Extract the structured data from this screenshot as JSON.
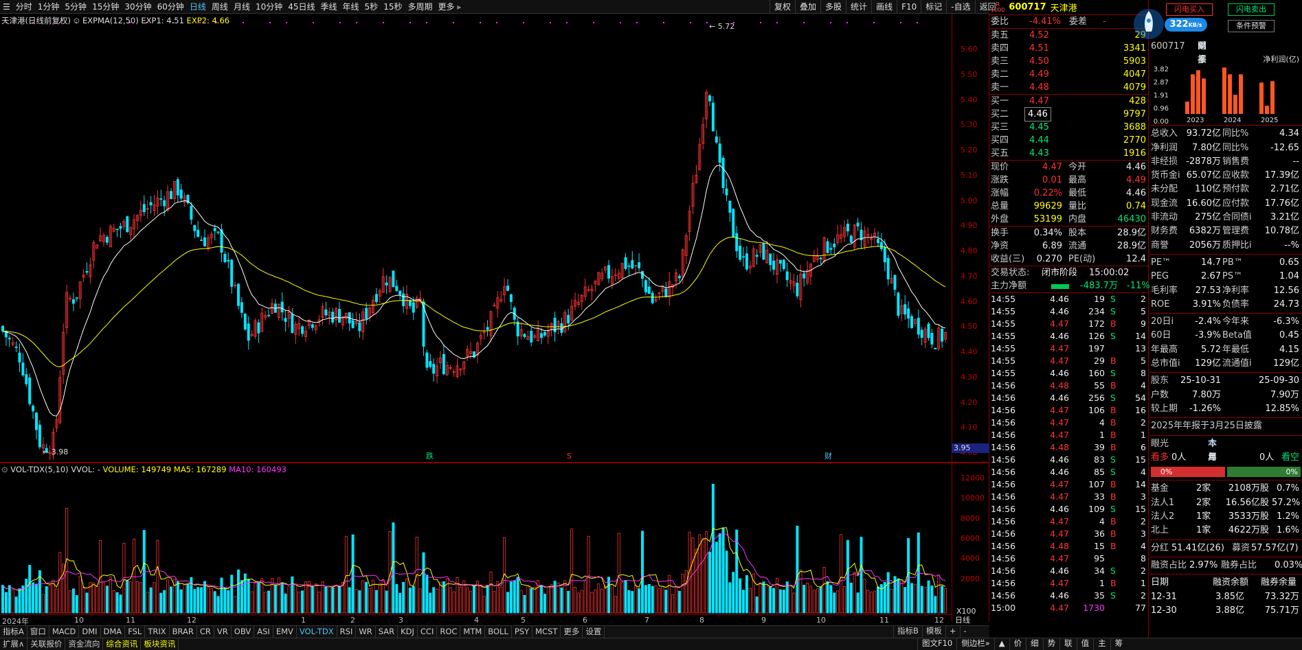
{
  "topbar": {
    "periods": [
      "分时",
      "1分钟",
      "5分钟",
      "15分钟",
      "30分钟",
      "60分钟",
      "日线",
      "周线",
      "月线",
      "10分钟",
      "45日线",
      "季线",
      "年线",
      "5秒",
      "15秒",
      "多周期",
      "更多"
    ],
    "active": "日线",
    "right": [
      "复权",
      "叠加",
      "多股",
      "统计",
      "画线",
      "F10",
      "标记",
      "-自选",
      "返回"
    ]
  },
  "kline": {
    "title": "天津港(日线前复权)",
    "indicator": "EXPMA(12,50)",
    "exp1_label": "EXP1: 4.51",
    "exp2_label": "EXP2: 4.66",
    "high_label": "5.72",
    "low_label": "3.98",
    "price_ticks": [
      "5.60",
      "5.50",
      "5.40",
      "5.30",
      "5.20",
      "5.10",
      "5.00",
      "4.90",
      "4.80",
      "4.70",
      "4.60",
      "4.50",
      "4.40",
      "4.30",
      "4.20",
      "4.10",
      "4.00"
    ],
    "current_price_tag": "3.95",
    "markers": [
      "跌",
      "S",
      "财"
    ]
  },
  "volume": {
    "indicator": "VOL-TDX(5,10)",
    "vvol_label": "VVOL: -",
    "volume_label": "VOLUME: 149749",
    "ma5_label": "MA5: 167289",
    "ma10_label": "MA10: 160493",
    "ticks": [
      "12000",
      "10000",
      "8000",
      "6000",
      "4000",
      "2000"
    ],
    "unit": "X100"
  },
  "time_axis": {
    "labels": [
      "2024年",
      "10",
      "11",
      "12",
      "1",
      "2",
      "3",
      "4",
      "5",
      "6",
      "7",
      "8",
      "9",
      "10",
      "11",
      "12"
    ],
    "period": "日线"
  },
  "bottom_tabs": [
    "指标A",
    "窗口",
    "MACD",
    "DMI",
    "DMA",
    "FSL",
    "TRIX",
    "BRAR",
    "CR",
    "VR",
    "OBV",
    "ASI",
    "EMV",
    "VOL-TDX",
    "RSI",
    "WR",
    "SAR",
    "KDJ",
    "CCI",
    "ROC",
    "MTM",
    "BOLL",
    "PSY",
    "MCST",
    "更多",
    "设置"
  ],
  "bottom_tabs_active": "VOL-TDX",
  "bottom_right": [
    "指标B",
    "模板",
    "+",
    "-"
  ],
  "status_tabs": [
    "扩展∧",
    "关联报价",
    "资金流向",
    "综合资讯",
    "板块资讯"
  ],
  "status_right": [
    "图文F10",
    "侧边栏»",
    "▲",
    "价",
    "细",
    "势",
    "联",
    "值",
    "主",
    "筹"
  ],
  "quote": {
    "badge_top": "R",
    "badge_bottom": "1000",
    "code": "600717",
    "name": "天津港",
    "wei_bi_label": "委比",
    "wei_bi": "-4.41%",
    "wei_cha_label": "委差",
    "wei_cha": "-",
    "sells": [
      {
        "label": "卖五",
        "price": "4.52",
        "vol": "29"
      },
      {
        "label": "卖四",
        "price": "4.51",
        "vol": "3341"
      },
      {
        "label": "卖三",
        "price": "4.50",
        "vol": "5903"
      },
      {
        "label": "卖二",
        "price": "4.49",
        "vol": "4047"
      },
      {
        "label": "卖一",
        "price": "4.48",
        "vol": "4079"
      }
    ],
    "buys": [
      {
        "label": "买一",
        "price": "4.47",
        "vol": "428"
      },
      {
        "label": "买二",
        "price": "4.46",
        "vol": "9797"
      },
      {
        "label": "买三",
        "price": "4.45",
        "vol": "3688"
      },
      {
        "label": "买四",
        "price": "4.44",
        "vol": "2770"
      },
      {
        "label": "买五",
        "price": "4.43",
        "vol": "1916"
      }
    ],
    "stats": [
      {
        "l1": "现价",
        "v1": "4.47",
        "l2": "今开",
        "v2": "4.46"
      },
      {
        "l1": "涨跌",
        "v1": "0.01",
        "l2": "最高",
        "v2": "4.49"
      },
      {
        "l1": "涨幅",
        "v1": "0.22%",
        "l2": "最低",
        "v2": "4.46"
      },
      {
        "l1": "总量",
        "v1": "99629",
        "l2": "量比",
        "v2": "0.74"
      },
      {
        "l1": "外盘",
        "v1": "53199",
        "l2": "内盘",
        "v2": "46430"
      }
    ],
    "stats2": [
      {
        "l1": "换手",
        "v1": "0.34%",
        "l2": "股本",
        "v2": "28.9亿"
      },
      {
        "l1": "净资",
        "v1": "6.89",
        "l2": "流通",
        "v2": "28.9亿"
      },
      {
        "l1": "收益(三)",
        "v1": "0.270",
        "l2": "PE(动)",
        "v2": "12.4"
      }
    ],
    "trade_state_label": "交易状态:",
    "trade_state": "闭市阶段",
    "trade_state_time": "15:00:02",
    "net_flow_label": "主力净额",
    "net_flow": "-483.7万",
    "net_flow_pct": "-11%",
    "trades": [
      {
        "t": "14:55",
        "p": "4.46",
        "v": "19",
        "d": "S",
        "n": "2"
      },
      {
        "t": "14:55",
        "p": "4.46",
        "v": "234",
        "d": "S",
        "n": "5"
      },
      {
        "t": "14:55",
        "p": "4.47",
        "v": "172",
        "d": "B",
        "n": "9"
      },
      {
        "t": "14:55",
        "p": "4.46",
        "v": "126",
        "d": "S",
        "n": "14"
      },
      {
        "t": "14:55",
        "p": "4.47",
        "v": "197",
        "d": "",
        "n": "13"
      },
      {
        "t": "14:55",
        "p": "4.47",
        "v": "29",
        "d": "B",
        "n": "5"
      },
      {
        "t": "14:55",
        "p": "4.46",
        "v": "160",
        "d": "S",
        "n": "8"
      },
      {
        "t": "14:56",
        "p": "4.48",
        "v": "55",
        "d": "B",
        "n": "4"
      },
      {
        "t": "14:56",
        "p": "4.46",
        "v": "256",
        "d": "S",
        "n": "54"
      },
      {
        "t": "14:56",
        "p": "4.47",
        "v": "106",
        "d": "B",
        "n": "16"
      },
      {
        "t": "14:56",
        "p": "4.47",
        "v": "4",
        "d": "B",
        "n": "2"
      },
      {
        "t": "14:56",
        "p": "4.47",
        "v": "1",
        "d": "B",
        "n": "1"
      },
      {
        "t": "14:56",
        "p": "4.48",
        "v": "39",
        "d": "B",
        "n": "6"
      },
      {
        "t": "14:56",
        "p": "4.46",
        "v": "83",
        "d": "S",
        "n": "15"
      },
      {
        "t": "14:56",
        "p": "4.46",
        "v": "85",
        "d": "S",
        "n": "4"
      },
      {
        "t": "14:56",
        "p": "4.47",
        "v": "107",
        "d": "B",
        "n": "14"
      },
      {
        "t": "14:56",
        "p": "4.47",
        "v": "33",
        "d": "B",
        "n": "3"
      },
      {
        "t": "14:56",
        "p": "4.46",
        "v": "109",
        "d": "S",
        "n": "15"
      },
      {
        "t": "14:56",
        "p": "4.47",
        "v": "4",
        "d": "B",
        "n": "2"
      },
      {
        "t": "14:56",
        "p": "4.47",
        "v": "36",
        "d": "B",
        "n": "3"
      },
      {
        "t": "14:56",
        "p": "4.48",
        "v": "15",
        "d": "B",
        "n": "4"
      },
      {
        "t": "14:56",
        "p": "4.47",
        "v": "95",
        "d": "",
        "n": "8"
      },
      {
        "t": "14:56",
        "p": "4.46",
        "v": "34",
        "d": "S",
        "n": "2"
      },
      {
        "t": "14:56",
        "p": "4.47",
        "v": "1",
        "d": "B",
        "n": "1"
      },
      {
        "t": "14:56",
        "p": "4.46",
        "v": "35",
        "d": "S",
        "n": "2"
      },
      {
        "t": "15:00",
        "p": "4.47",
        "v": "1730",
        "d": "",
        "n": "77"
      }
    ]
  },
  "buttons": {
    "flash_buy": "闪电买入",
    "flash_sell": "闪电卖出",
    "cond_alert": "条件预警",
    "speed_value": "322",
    "speed_unit": "KB/s"
  },
  "fin": {
    "code": "600717",
    "tabs": [
      "单季",
      "同季",
      "财报",
      "更多"
    ],
    "chart_title": "净利润(亿)",
    "chart_data": {
      "type": "bar",
      "title": "净利润(亿)",
      "categories": [
        "2023",
        "2024",
        "2025"
      ],
      "y_ticks": [
        "3.82",
        "2.87",
        "1.91",
        "0.96",
        "0.00"
      ],
      "ylim": [
        0,
        3.82
      ],
      "series": [
        {
          "year": "2023",
          "values": [
            0.9,
            2.9,
            3.2,
            2.6
          ]
        },
        {
          "year": "2024",
          "values": [
            3.4,
            2.9,
            1.4,
            2.9
          ]
        },
        {
          "year": "2025",
          "values": [
            2.3,
            0.6,
            2.4
          ]
        }
      ]
    },
    "rows1": [
      {
        "l1": "总收入",
        "v1": "93.72亿",
        "l2": "同比%",
        "v2": "4.34"
      },
      {
        "l1": "净利润",
        "v1": "7.80亿",
        "l2": "同比%",
        "v2": "-12.65"
      },
      {
        "l1": "非经损",
        "v1": "-2878万",
        "l2": "销售费",
        "v2": "--"
      },
      {
        "l1": "货币金i",
        "v1": "65.07亿",
        "l2": "应收款",
        "v2": "17.39亿"
      },
      {
        "l1": "未分配",
        "v1": "110亿",
        "l2": "预付款",
        "v2": "2.71亿"
      },
      {
        "l1": "现金流",
        "v1": "16.60亿",
        "l2": "应付款",
        "v2": "17.76亿"
      },
      {
        "l1": "非流动",
        "v1": "275亿",
        "l2": "合同债i",
        "v2": "3.21亿"
      },
      {
        "l1": "财务费",
        "v1": "6382万",
        "l2": "管理费",
        "v2": "10.78亿"
      },
      {
        "l1": "商誉",
        "v1": "2056万",
        "l2": "质押比i",
        "v2": "--%"
      }
    ],
    "rows2": [
      {
        "l1": "PE™",
        "v1": "14.7",
        "l2": "PB™",
        "v2": "0.65"
      },
      {
        "l1": "PEG",
        "v1": "2.67",
        "l2": "PS™",
        "v2": "1.04"
      },
      {
        "l1": "毛利率",
        "v1": "27.53",
        "l2": "净利率",
        "v2": "12.56"
      },
      {
        "l1": "ROE",
        "v1": "3.91%",
        "l2": "负债率",
        "v2": "24.73"
      }
    ],
    "rows3": [
      {
        "l1": "20日i",
        "v1": "-2.4%",
        "l2": "今年来",
        "v2": "-6.3%"
      },
      {
        "l1": "60日",
        "v1": "-3.9%",
        "l2": "Beta值",
        "v2": "0.45"
      },
      {
        "l1": "年最高",
        "v1": "5.72",
        "l2": "年最低",
        "v2": "4.15"
      },
      {
        "l1": "总市值i",
        "v1": "129亿",
        "l2": "流通值i",
        "v2": "129亿"
      }
    ],
    "rows4": [
      {
        "l1": "股东",
        "v1": "25-10-31",
        "l2": "",
        "v2": "25-09-30"
      },
      {
        "l1": "户数",
        "v1": "7.80万",
        "l2": "",
        "v2": "7.90万"
      },
      {
        "l1": "较上期",
        "v1": "-1.26%",
        "l2": "",
        "v2": "12.85%"
      }
    ],
    "report_note": "2025年年报于3月25日披露",
    "eye_label": "眼光",
    "eye_tabs": [
      "今日",
      "本周",
      "本月",
      "本年"
    ],
    "bull_label": "看多",
    "bull_count": "0人",
    "bear_count": "0人",
    "bear_label": "看空",
    "bull_pct": "0%",
    "bear_pct": "0%",
    "holders": [
      {
        "l": "基金",
        "n": "2家",
        "s": "2108万股",
        "p": "0.7%"
      },
      {
        "l": "法人1",
        "n": "2家",
        "s": "16.56亿股",
        "p": "57.2%"
      },
      {
        "l": "法人2",
        "n": "1家",
        "s": "3533万股",
        "p": "1.2%"
      },
      {
        "l": "北上",
        "n": "1家",
        "s": "4622万股",
        "p": "1.6%"
      }
    ],
    "dividend_label": "分红",
    "dividend": "51.41亿(26)",
    "raise_label": "募资",
    "raise": "57.57亿(7)",
    "margin_label": "融资占比",
    "margin": "2.97%",
    "short_label": "融券占比",
    "short": "0.03%",
    "margin_head": [
      "日期",
      "融资余额",
      "融券余量"
    ],
    "margin_rows": [
      {
        "d": "12-31",
        "a": "3.85亿",
        "b": "73.32万"
      },
      {
        "d": "12-30",
        "a": "3.88亿",
        "b": "75.71万"
      }
    ]
  },
  "colors": {
    "up": "#ff3333",
    "down": "#00e5ff",
    "exp1": "#ffffff",
    "exp2": "#ffff00",
    "ma10": "#ff33ff",
    "border": "#8b0000"
  }
}
